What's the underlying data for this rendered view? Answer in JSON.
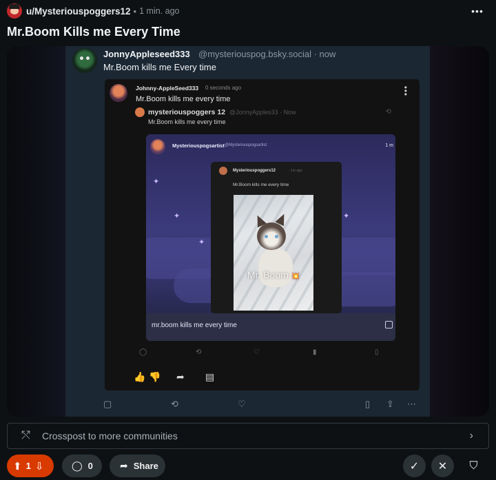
{
  "post": {
    "author": "u/Mysteriouspoggers12",
    "separator": "•",
    "time": "1 min. ago",
    "more_icon": "•••",
    "title": "Mr.Boom Kills me Every Time"
  },
  "embed": {
    "bsky_name": "JonnyAppleseed333",
    "bsky_handle": "@mysteriouspog.bsky.social · now",
    "bsky_text": "Mr.Boom kills me Every time",
    "card": {
      "name": "Johnny-AppleSeed333",
      "time": "0 seconds ago",
      "text": "Mr.Boom kills me every time",
      "quote": {
        "name": "mysteriouspoggers 12",
        "handle": "@JonnyApples33 · Now",
        "text": "Mr.Boom kills me every time",
        "inner": {
          "name": "Mysteriouspogsartist",
          "handle": "@Mysteriouspogsartist",
          "trunc": "1 m",
          "nested": {
            "name": "Mysteriouspoggers12",
            "time": "· 1m ago",
            "text": "Mr.Boom kills me every time",
            "photo_caption": "Mr. Boom",
            "photo_spark": "💥"
          },
          "footer_text": "mr.boom kills me every time"
        }
      }
    }
  },
  "crosspost": {
    "label": "Crosspost to more communities"
  },
  "actions": {
    "vote_count": "1",
    "comment_count": "0",
    "share_label": "Share"
  },
  "colors": {
    "upvote_active": "#d93a00",
    "pill_bg": "#2a3236",
    "page_bg": "#0e1113"
  }
}
